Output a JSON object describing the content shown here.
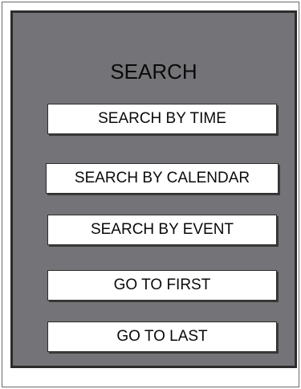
{
  "menu": {
    "title": "SEARCH",
    "buttons": {
      "search_by_time": "SEARCH BY TIME",
      "search_by_calendar": "SEARCH BY CALENDAR",
      "search_by_event": "SEARCH BY EVENT",
      "go_to_first": "GO TO FIRST",
      "go_to_last": "GO TO LAST"
    }
  },
  "colors": {
    "panel_background": "#747478",
    "panel_border": "#2c2c2c",
    "button_background": "#ffffff",
    "text": "#0a0a0a"
  }
}
